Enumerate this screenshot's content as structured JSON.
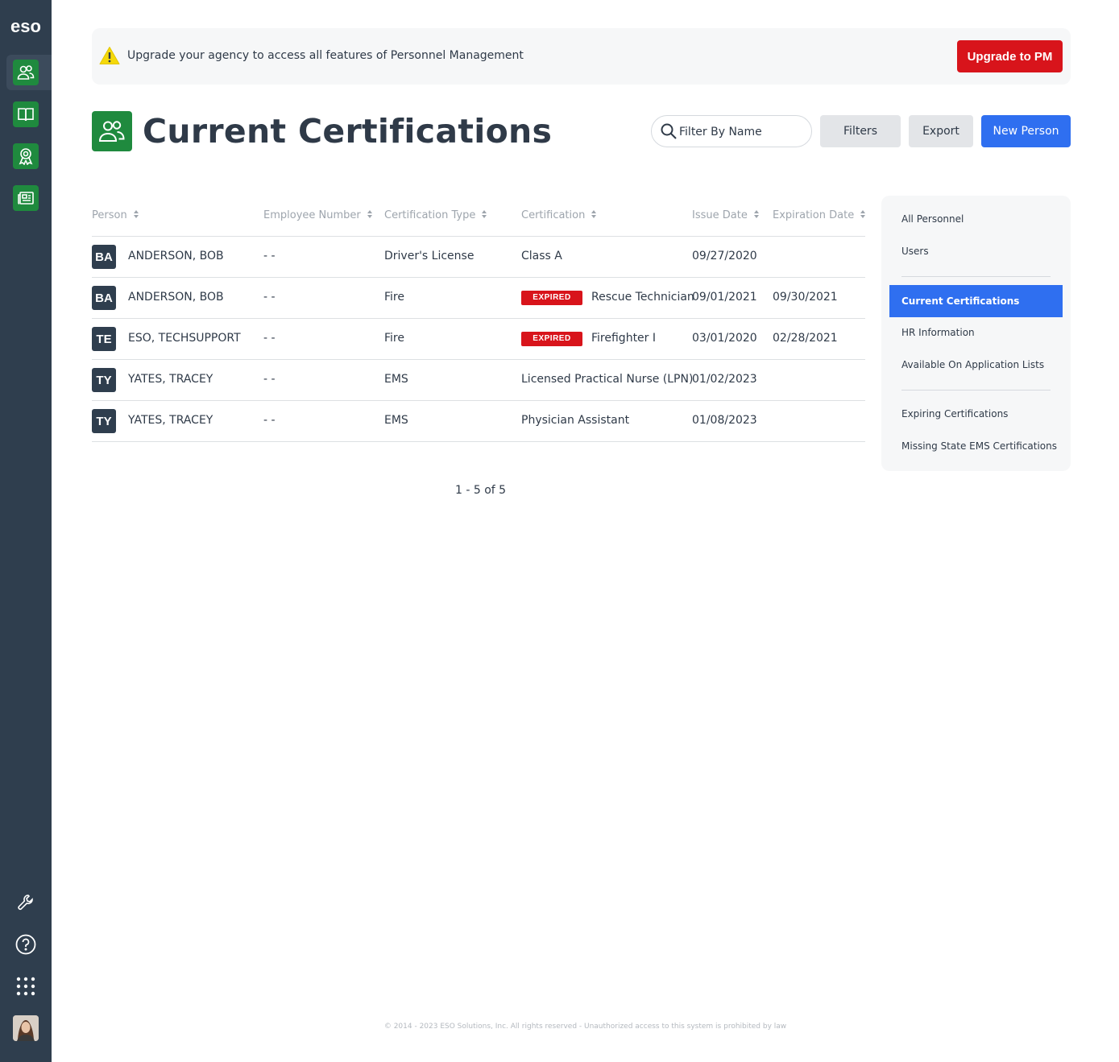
{
  "rail": {
    "logo": "eso",
    "apps": [
      {
        "icon": "people-icon"
      },
      {
        "icon": "book-icon"
      },
      {
        "icon": "award-icon"
      },
      {
        "icon": "news-icon"
      }
    ],
    "tools": [
      {
        "icon": "wrench-icon"
      },
      {
        "icon": "help-circle-icon"
      },
      {
        "icon": "app-grid-icon"
      }
    ],
    "avatar_icon": "user-avatar"
  },
  "banner": {
    "icon": "warning-icon",
    "message": "Upgrade your agency to access all features of Personnel Management",
    "button_label": "Upgrade to PM",
    "button_color": "#d8141b"
  },
  "header": {
    "title": "Current Certifications",
    "icon": "people-icon",
    "search_placeholder": "Filter By Name",
    "filters_label": "Filters",
    "export_label": "Export",
    "new_person_label": "New Person",
    "accent_color": "#2f6ff0",
    "brand_color": "#1f8a3e"
  },
  "table": {
    "columns": [
      "Person",
      "Employee Number",
      "Certification Type",
      "Certification",
      "Issue Date",
      "Expiration Date"
    ],
    "rows": [
      {
        "initials": "BA",
        "person": "ANDERSON, BOB",
        "employee_number": "- -",
        "type": "Driver's License",
        "expired": "",
        "certification": "Class A",
        "issue_date": "09/27/2020",
        "expiration_date": ""
      },
      {
        "initials": "BA",
        "person": "ANDERSON, BOB",
        "employee_number": "- -",
        "type": "Fire",
        "expired": "EXPIRED",
        "certification": "Rescue Technician",
        "issue_date": "09/01/2021",
        "expiration_date": "09/30/2021"
      },
      {
        "initials": "TE",
        "person": "ESO, TECHSUPPORT",
        "employee_number": "- -",
        "type": "Fire",
        "expired": "EXPIRED",
        "certification": "Firefighter I",
        "issue_date": "03/01/2020",
        "expiration_date": "02/28/2021"
      },
      {
        "initials": "TY",
        "person": "YATES, TRACEY",
        "employee_number": "- -",
        "type": "EMS",
        "expired": "",
        "certification": "Licensed Practical Nurse (LPN)",
        "issue_date": "01/02/2023",
        "expiration_date": ""
      },
      {
        "initials": "TY",
        "person": "YATES, TRACEY",
        "employee_number": "- -",
        "type": "EMS",
        "expired": "",
        "certification": "Physician Assistant",
        "issue_date": "01/08/2023",
        "expiration_date": ""
      }
    ],
    "pagination": "1 - 5 of 5"
  },
  "sidenav": {
    "items": [
      {
        "label": "All Personnel",
        "active": false
      },
      {
        "label": "Users",
        "active": false
      },
      {
        "label": "Current Certifications",
        "active": true
      },
      {
        "label": "HR Information",
        "active": false
      },
      {
        "label": "Available On Application Lists",
        "active": false
      },
      {
        "label": "Expiring Certifications",
        "active": false
      },
      {
        "label": "Missing State EMS Certifications",
        "active": false
      }
    ]
  },
  "footer": "© 2014 - 2023 ESO Solutions, Inc. All rights reserved - Unauthorized access to this system is prohibited by law"
}
